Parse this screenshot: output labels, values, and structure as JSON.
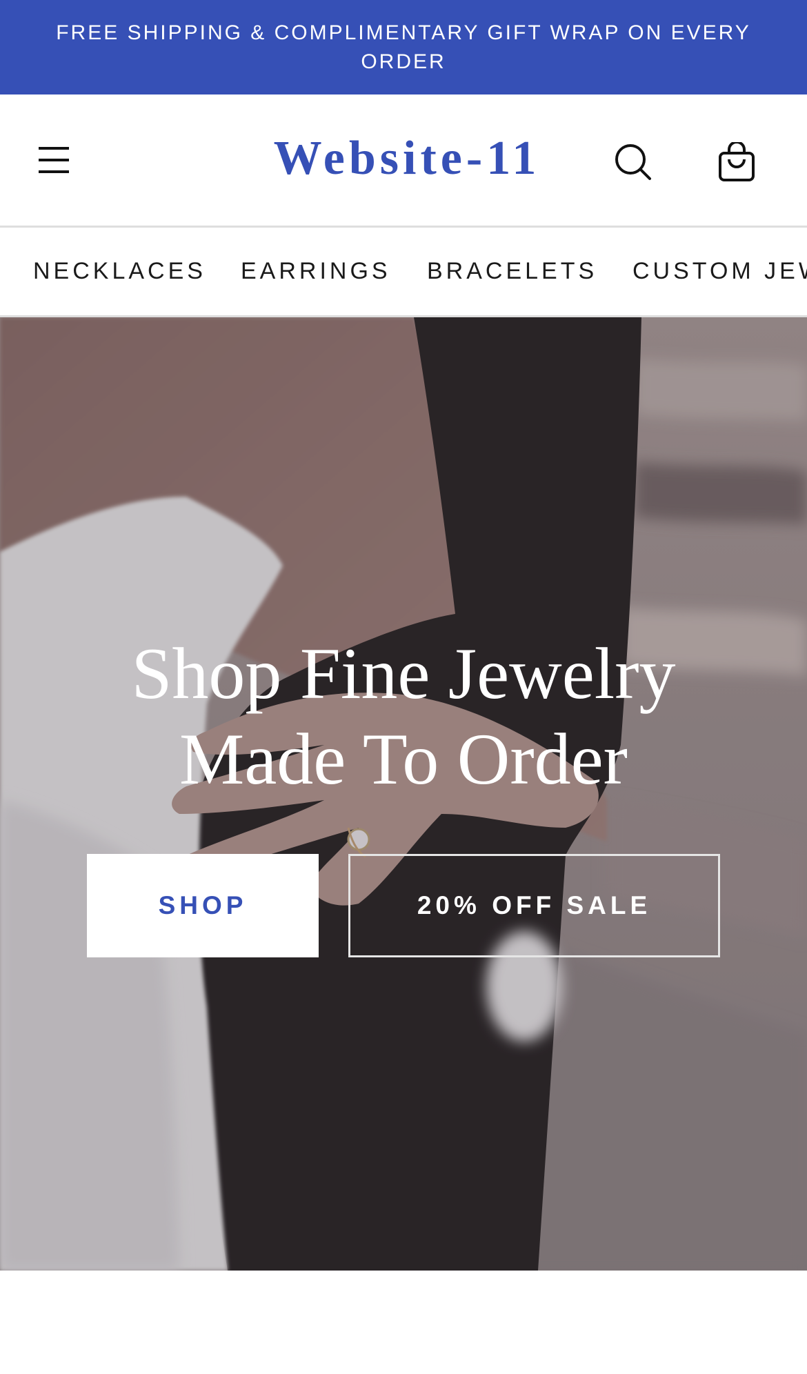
{
  "announcement": {
    "line1": "FREE SHIPPING & COMPLIMENTARY GIFT WRAP ON EVERY",
    "line2": "ORDER"
  },
  "header": {
    "logo": "Website-11",
    "menu_icon": "hamburger-menu-icon",
    "search_icon": "search-icon",
    "cart_icon": "shopping-bag-icon"
  },
  "categories": [
    {
      "label": "NECKLACES"
    },
    {
      "label": "EARRINGS"
    },
    {
      "label": "BRACELETS"
    },
    {
      "label": "CUSTOM JEWELRY"
    }
  ],
  "hero": {
    "title_line1": "Shop Fine Jewelry",
    "title_line2": "Made To Order",
    "primary_button": "SHOP",
    "secondary_button": "20% OFF SALE"
  },
  "colors": {
    "brand": "#3650b6",
    "text": "#1a1a1a",
    "divider": "#dedede"
  }
}
